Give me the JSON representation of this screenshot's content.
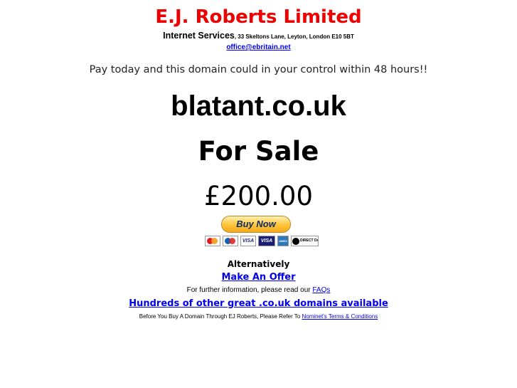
{
  "company_name": "E.J. Roberts Limited",
  "header": {
    "services": "Internet Services",
    "address": ", 33 Skeltons Lane, Leyton, London E10 5BT",
    "email": "office@ebritain.net"
  },
  "tagline": "Pay today and this domain could in your control within 48 hours!!",
  "domain_name": "blatant.co.uk",
  "for_sale": "For Sale",
  "price": "£200.00",
  "buy_now": {
    "label": "Buy Now",
    "cards": [
      "Mastercard",
      "Maestro",
      "VISA",
      "VISA",
      "AMEX",
      "DIRECT Debit"
    ]
  },
  "alternatively": "Alternatively",
  "make_offer": "Make An Offer",
  "further_info": {
    "text": "For further information, please read our ",
    "link": "FAQs "
  },
  "other_domains": "Hundreds of other great .co.uk domains available ",
  "before_buy": {
    "text": "Before You Buy A Domain Through EJ Roberts, Please Refer To ",
    "link": "Nominet's Terms & Conditions"
  },
  "colors": {
    "brand_red": "#ee0000",
    "link_blue": "#0000ee",
    "buy_button_yellow": "#ffc439"
  }
}
